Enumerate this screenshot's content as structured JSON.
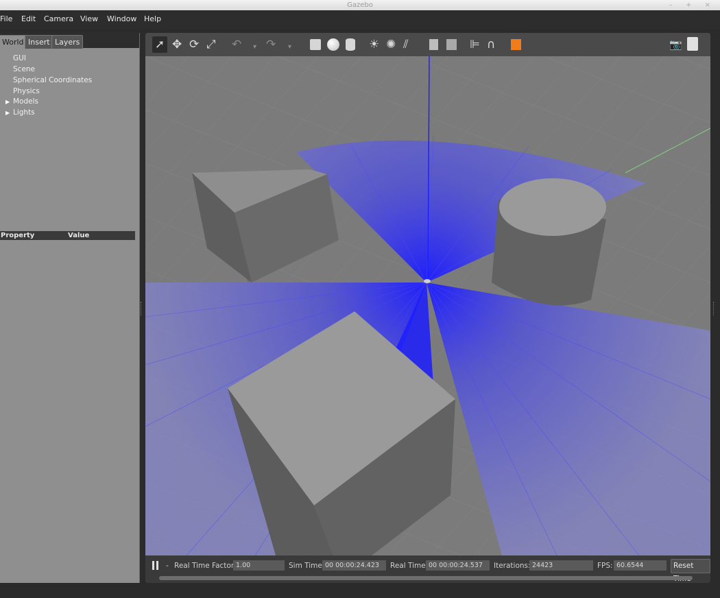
{
  "window": {
    "title": "Gazebo",
    "controls": "– + ×"
  },
  "menu": [
    "File",
    "Edit",
    "Camera",
    "View",
    "Window",
    "Help"
  ],
  "tabs": [
    "World",
    "Insert",
    "Layers"
  ],
  "tree": {
    "items": [
      "GUI",
      "Scene",
      "Spherical Coordinates",
      "Physics"
    ],
    "expandable": [
      "Models",
      "Lights"
    ]
  },
  "properties": {
    "col_property": "Property",
    "col_value": "Value"
  },
  "toolbar_icons": [
    "select-arrow-icon",
    "translate-icon",
    "rotate-icon",
    "scale-icon",
    "undo-icon",
    "undo-dropdown-icon",
    "redo-icon",
    "redo-dropdown-icon",
    "box-icon",
    "sphere-icon",
    "cylinder-icon",
    "point-light-icon",
    "spot-light-icon",
    "directional-light-icon",
    "copy-icon",
    "paste-icon",
    "align-icon",
    "snap-icon",
    "view-angle-icon",
    "screenshot-icon",
    "log-icon"
  ],
  "bottom": {
    "rtf_label": "Real Time Factor:",
    "rtf_value": "1.00",
    "sim_label": "Sim Time:",
    "sim_value": "00 00:00:24.423",
    "real_label": "Real Time:",
    "real_value": "00 00:00:24.537",
    "iter_label": "Iterations:",
    "iter_value": "24423",
    "fps_label": "FPS:",
    "fps_value": "60.6544",
    "reset_label": "Reset Time",
    "step_label": "-"
  },
  "colors": {
    "laser": "#3b3bff",
    "ground": "#7b7b7b",
    "object": "#9a9a9a"
  }
}
